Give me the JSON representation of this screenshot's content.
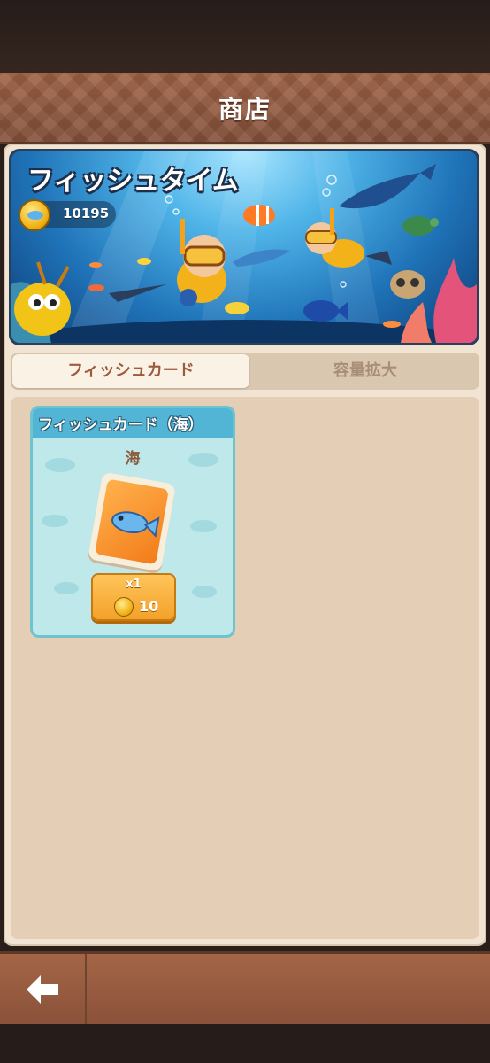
{
  "header": {
    "title": "商店"
  },
  "banner": {
    "title": "フィッシュタイム",
    "coin_icon": "fish-coin-icon",
    "coin_count": "10195"
  },
  "tabs": [
    {
      "label": "フィッシュカード",
      "active": true
    },
    {
      "label": "容量拡大",
      "active": false
    }
  ],
  "products": [
    {
      "title": "フィッシュカード（海）",
      "subtitle": "海",
      "icon": "fish-card-icon",
      "quantity": "x1",
      "price": "10",
      "price_icon": "fish-coin-icon"
    }
  ],
  "footer": {
    "back_icon": "back-arrow-icon"
  },
  "colors": {
    "header_bg": "#9e6244",
    "panel_bg": "#f1e4d2",
    "tab_active_text": "#9c5b3c",
    "card_bg": "#bfe8ea",
    "card_header": "#52b5d6",
    "buy_button": "#f3a22a"
  }
}
